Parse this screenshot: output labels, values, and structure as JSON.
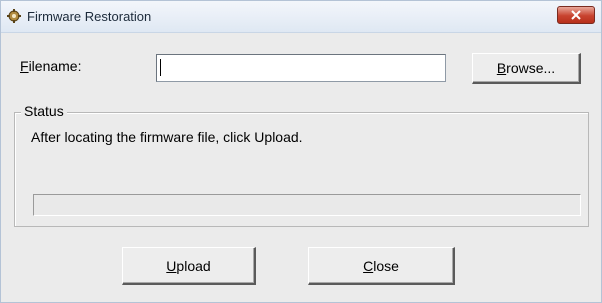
{
  "window": {
    "title": "Firmware Restoration",
    "app_icon": "firmware-restoration-app-icon",
    "close_icon": "close-x-icon",
    "close_color": "#c8432f"
  },
  "filename": {
    "label_mnemonic": "F",
    "label_rest": "ilename:",
    "value": "",
    "placeholder": ""
  },
  "browse": {
    "label_mnemonic": "B",
    "label_rest": "rowse..."
  },
  "status": {
    "group_label": "Status",
    "message": "After locating the firmware file, click Upload.",
    "progress": 0
  },
  "actions": {
    "upload_mnemonic": "U",
    "upload_rest": "pload",
    "close_mnemonic": "C",
    "close_rest": "lose"
  }
}
